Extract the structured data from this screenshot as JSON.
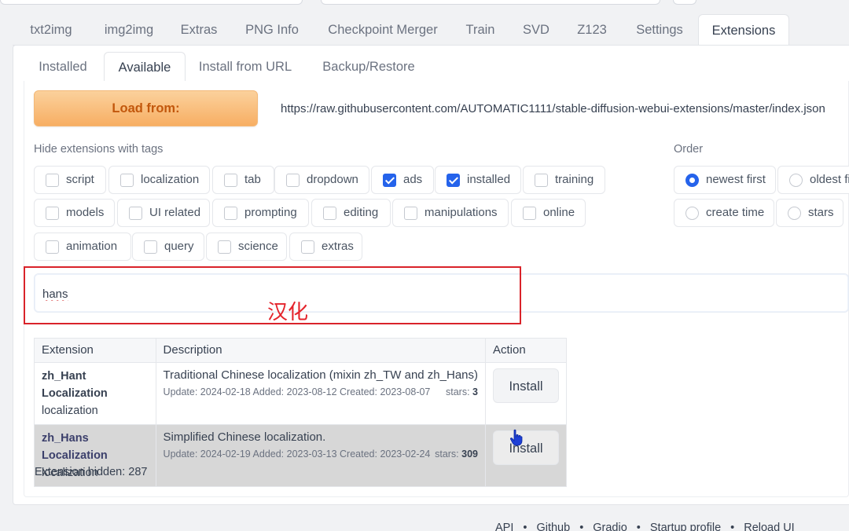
{
  "main_tabs": [
    {
      "label": "txt2img"
    },
    {
      "label": "img2img"
    },
    {
      "label": "Extras"
    },
    {
      "label": "PNG Info"
    },
    {
      "label": "Checkpoint Merger"
    },
    {
      "label": "Train"
    },
    {
      "label": "SVD"
    },
    {
      "label": "Z123"
    },
    {
      "label": "Settings"
    },
    {
      "label": "Extensions",
      "active": true
    }
  ],
  "sub_tabs": [
    {
      "label": "Installed"
    },
    {
      "label": "Available",
      "active": true
    },
    {
      "label": "Install from URL"
    },
    {
      "label": "Backup/Restore"
    }
  ],
  "load": {
    "button_label": "Load from:",
    "url": "https://raw.githubusercontent.com/AUTOMATIC1111/stable-diffusion-webui-extensions/master/index.json"
  },
  "hide_tags": {
    "label": "Hide extensions with tags",
    "tags": [
      {
        "label": "script",
        "checked": false
      },
      {
        "label": "localization",
        "checked": false
      },
      {
        "label": "tab",
        "checked": false
      },
      {
        "label": "dropdown",
        "checked": false
      },
      {
        "label": "ads",
        "checked": true
      },
      {
        "label": "installed",
        "checked": true
      },
      {
        "label": "training",
        "checked": false
      },
      {
        "label": "models",
        "checked": false
      },
      {
        "label": "UI related",
        "checked": false
      },
      {
        "label": "prompting",
        "checked": false
      },
      {
        "label": "editing",
        "checked": false
      },
      {
        "label": "manipulations",
        "checked": false
      },
      {
        "label": "online",
        "checked": false
      },
      {
        "label": "animation",
        "checked": false
      },
      {
        "label": "query",
        "checked": false
      },
      {
        "label": "science",
        "checked": false
      },
      {
        "label": "extras",
        "checked": false
      }
    ]
  },
  "order": {
    "label": "Order",
    "options": [
      {
        "label": "newest first",
        "selected": true
      },
      {
        "label": "oldest first",
        "selected": false
      },
      {
        "label": "create time",
        "selected": false
      },
      {
        "label": "stars",
        "selected": false
      }
    ]
  },
  "search": {
    "value": "hans"
  },
  "annotation": {
    "text": "汉化",
    "color": "#e4232b"
  },
  "table": {
    "headers": [
      "Extension",
      "Description",
      "Action"
    ],
    "rows": [
      {
        "name_line1": "zh_Hant Localization",
        "name_line2": "localization",
        "description": "Traditional Chinese localization (mixin zh_TW and zh_Hans)",
        "meta": "Update: 2024-02-18 Added: 2023-08-12 Created: 2023-08-07",
        "stars_label": "stars:",
        "stars": "3",
        "action": "Install"
      },
      {
        "name_line1": "zh_Hans Localization",
        "name_line2": "localization",
        "description": "Simplified Chinese localization.",
        "meta": "Update: 2024-02-19 Added: 2023-03-13 Created: 2023-02-24",
        "stars_label": "stars:",
        "stars": "309",
        "action": "Install"
      }
    ]
  },
  "hidden": {
    "text": "Extension hidden: 287"
  },
  "footer": {
    "links": [
      "API",
      "Github",
      "Gradio",
      "Startup profile",
      "Reload UI"
    ]
  },
  "colors": {
    "accent": "#2563eb",
    "load_button": "#f7ae63",
    "annotation_red": "#d9232a"
  }
}
